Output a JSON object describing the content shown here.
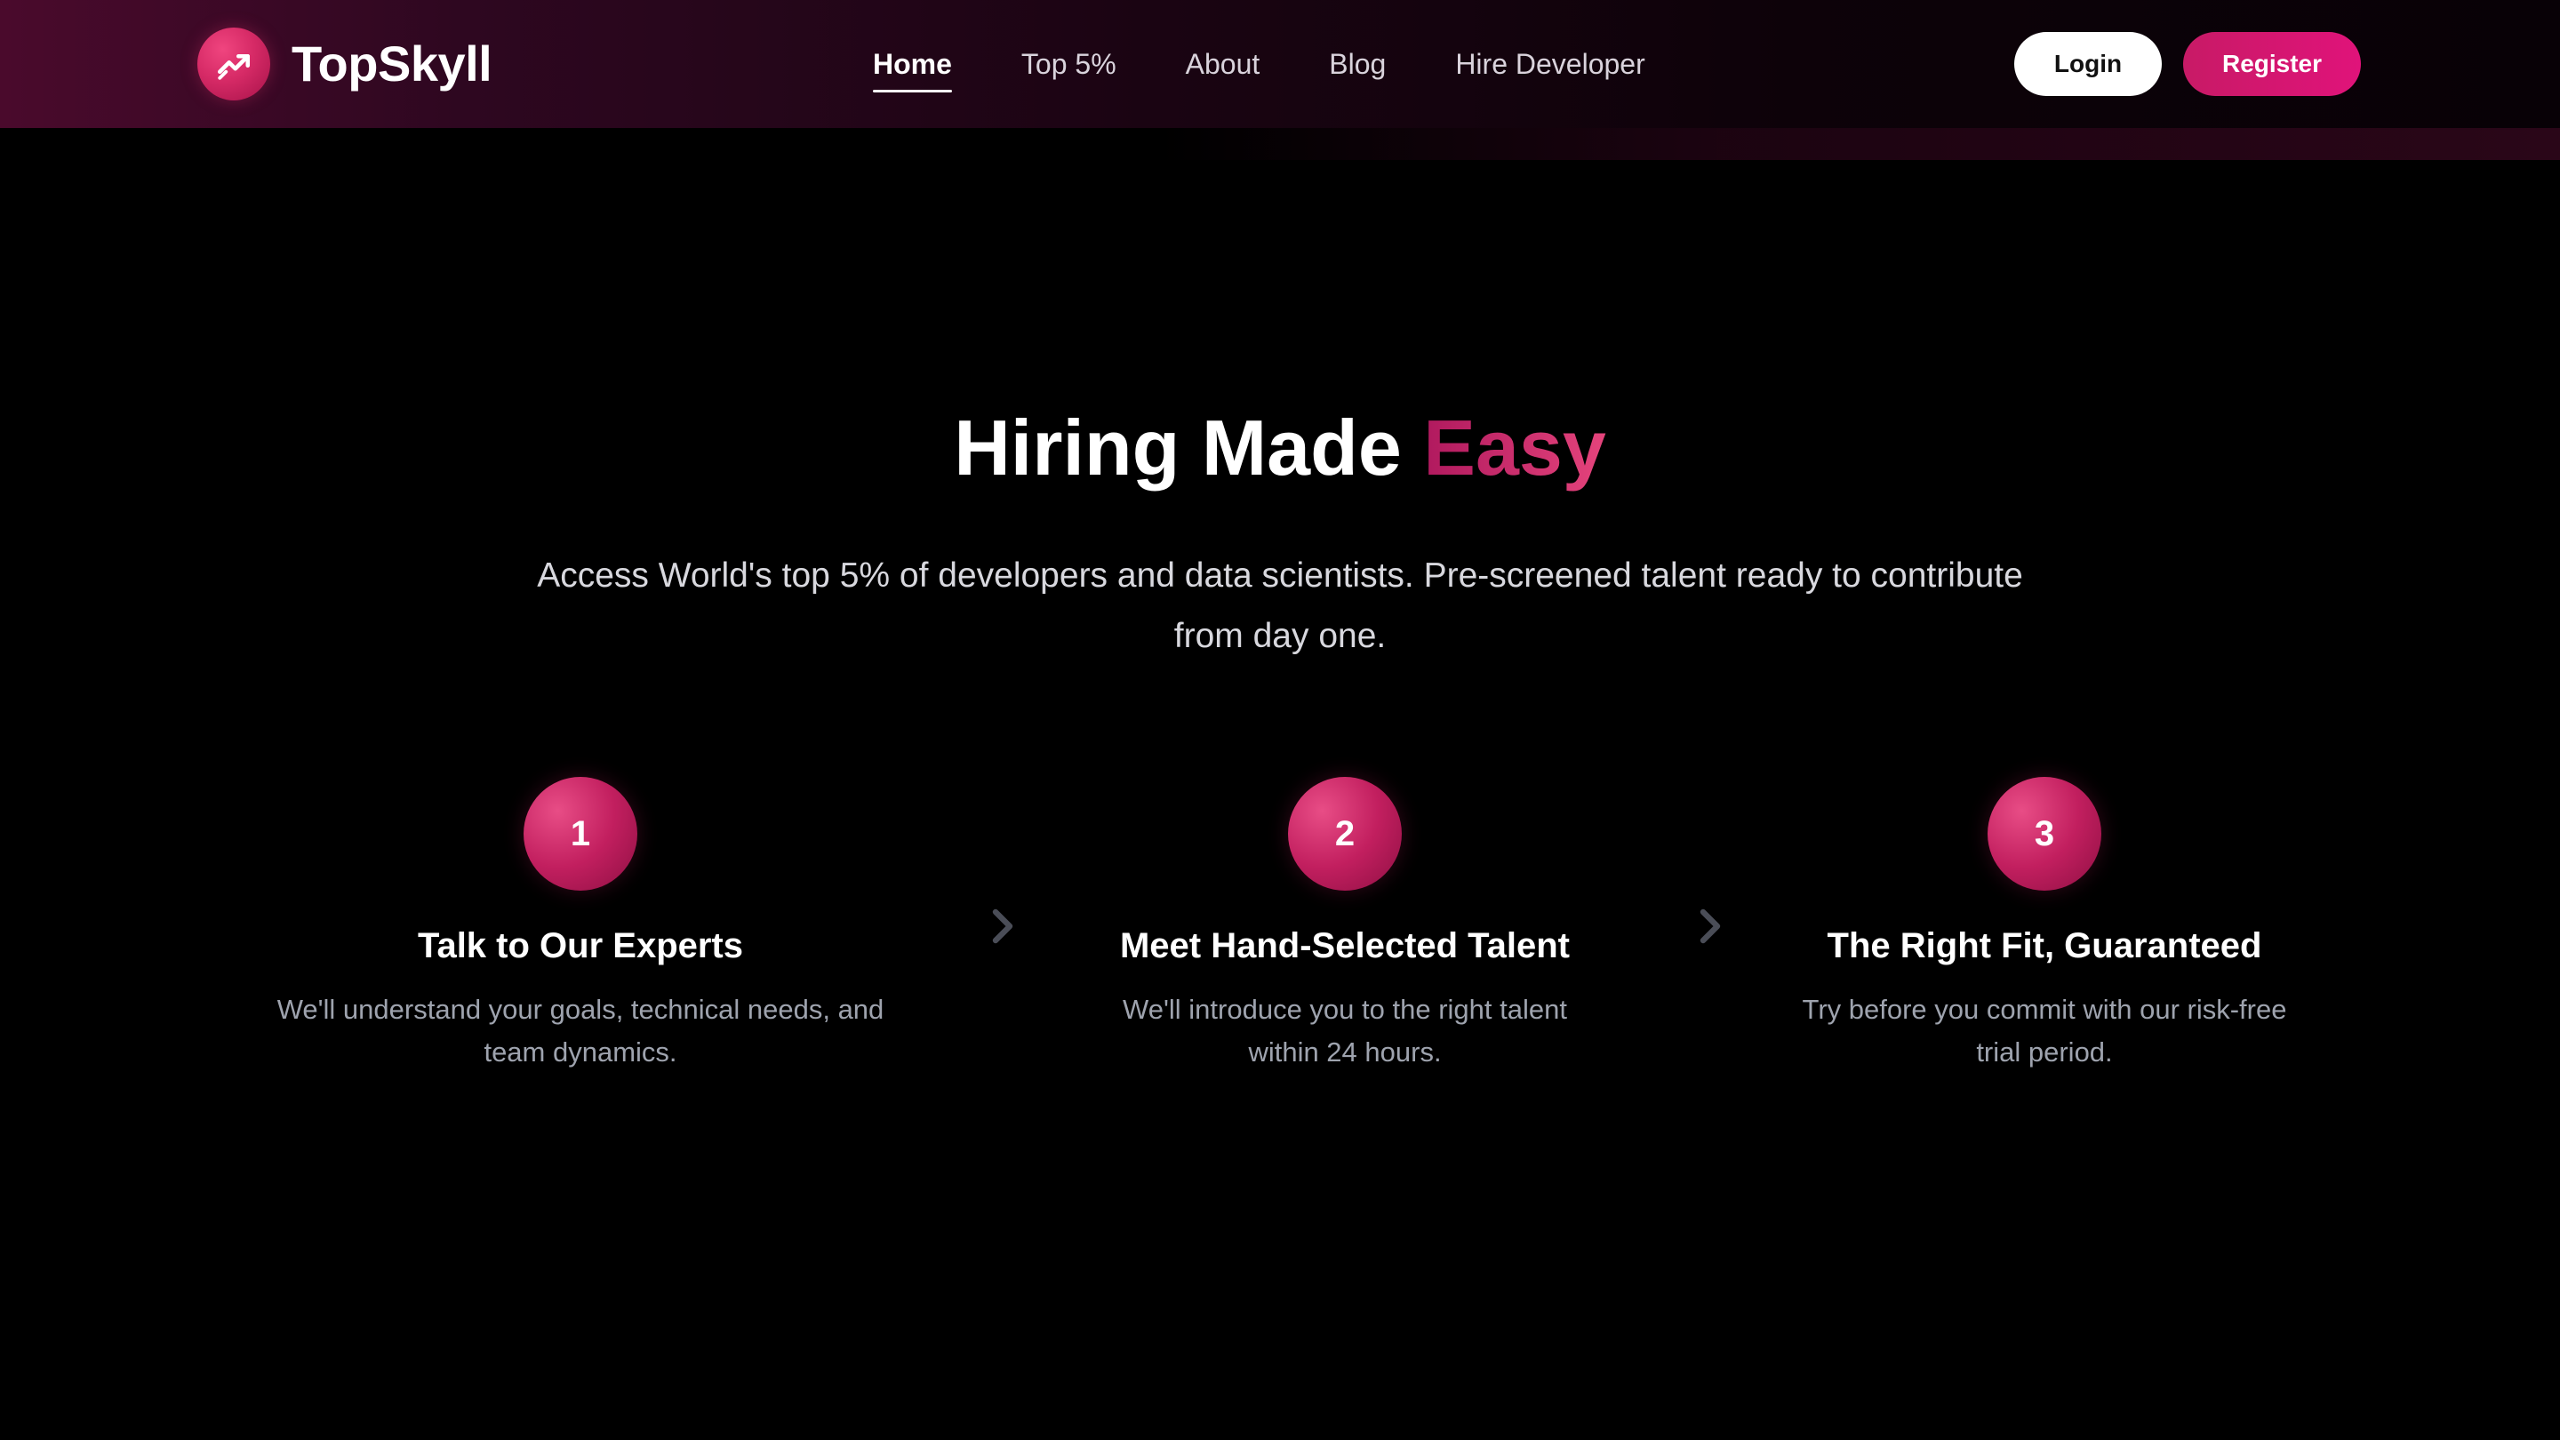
{
  "brand": {
    "name": "TopSkyll",
    "logo_icon": "trending-up-icon"
  },
  "nav": {
    "items": [
      {
        "label": "Home",
        "active": true
      },
      {
        "label": "Top 5%",
        "active": false
      },
      {
        "label": "About",
        "active": false
      },
      {
        "label": "Blog",
        "active": false
      },
      {
        "label": "Hire Developer",
        "active": false
      }
    ],
    "login_label": "Login",
    "register_label": "Register"
  },
  "hero": {
    "title_main": "Hiring Made ",
    "title_accent": "Easy",
    "subtitle": "Access World's top 5% of developers and data scientists. Pre-screened talent ready to contribute from day one."
  },
  "steps": [
    {
      "number": "1",
      "title": "Talk to Our Experts",
      "description": "We'll understand your goals, technical needs, and team dynamics."
    },
    {
      "number": "2",
      "title": "Meet Hand-Selected Talent",
      "description": "We'll introduce you to the right talent within 24 hours."
    },
    {
      "number": "3",
      "title": "The Right Fit, Guaranteed",
      "description": "Try before you commit with our risk-free trial period."
    }
  ],
  "colors": {
    "accent": "#d62a66",
    "register_button": "#e0137a",
    "background": "#000000",
    "navbar_start": "#4a0a2c"
  }
}
